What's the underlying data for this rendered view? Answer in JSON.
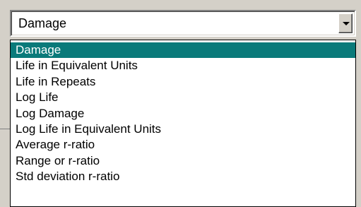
{
  "combo": {
    "value": "Damage",
    "dropdown_icon": "chevron-down-icon"
  },
  "list": {
    "selected_index": 0,
    "items": [
      {
        "label": "Damage"
      },
      {
        "label": "Life in Equivalent Units"
      },
      {
        "label": "Life in Repeats"
      },
      {
        "label": "Log Life"
      },
      {
        "label": "Log Damage"
      },
      {
        "label": "Log Life in Equivalent Units"
      },
      {
        "label": "Average r-ratio"
      },
      {
        "label": "Range or r-ratio"
      },
      {
        "label": "Std deviation r-ratio"
      }
    ]
  },
  "colors": {
    "selection": "#0a7a7a",
    "window_bg": "#d4d0c8"
  }
}
